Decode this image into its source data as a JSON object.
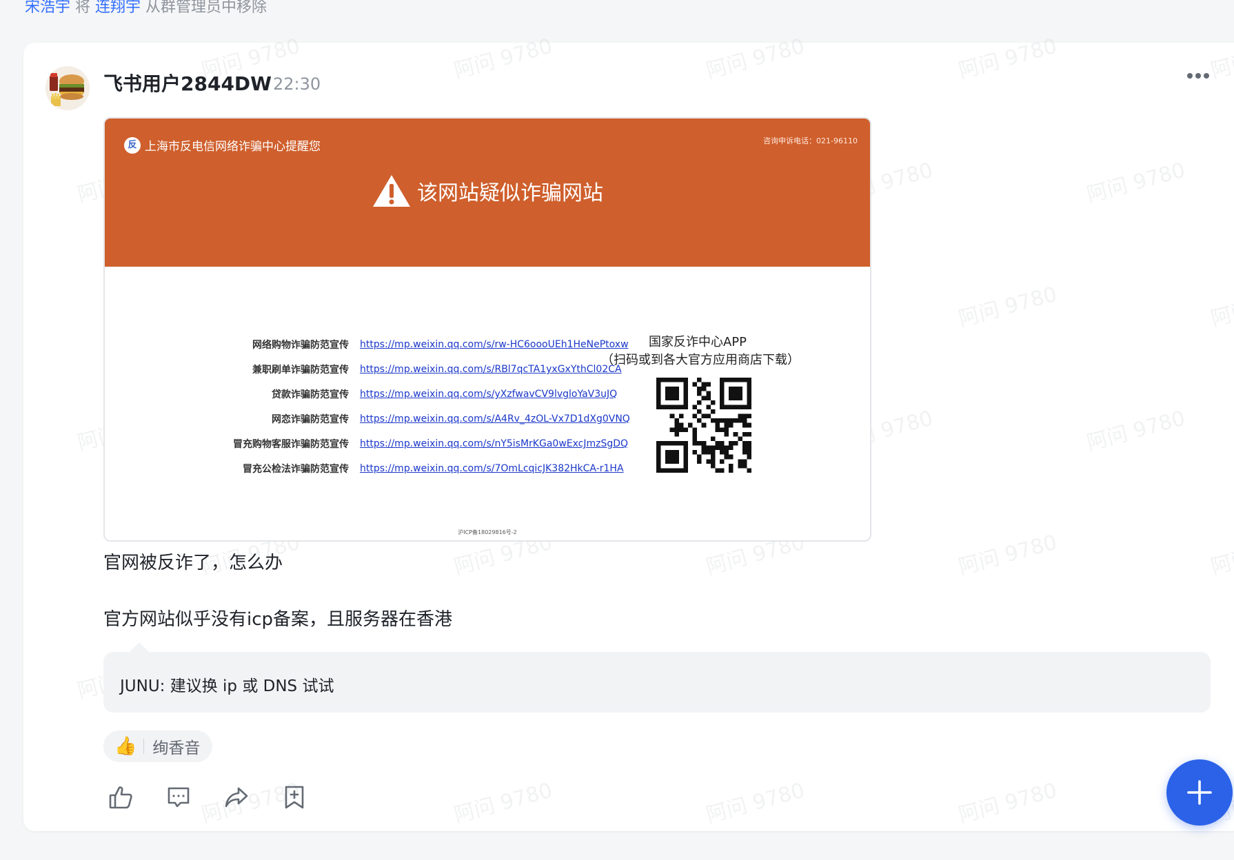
{
  "system_message": {
    "actor": "宋浩宇",
    "verb": "将",
    "target": "连翔宇",
    "action": "从群管理员中移除"
  },
  "post": {
    "author": "飞书用户2844DW",
    "time": "22:30",
    "avatar_icon": "burger-avatar-icon",
    "image": {
      "org_name": "上海市反电信网络诈骗中心提醒您",
      "org_logo": "反",
      "phone": "咨询申诉电话：021-96110",
      "warning_title": "该网站疑似诈骗网站",
      "links": [
        {
          "label": "网络购物诈骗防范宣传",
          "url": "https://mp.weixin.qq.com/s/rw-HC6oooUEh1HeNePtoxw"
        },
        {
          "label": "兼职刷单诈骗防范宣传",
          "url": "https://mp.weixin.qq.com/s/RBl7qcTA1yxGxYthCl02CA"
        },
        {
          "label": "贷款诈骗防范宣传",
          "url": "https://mp.weixin.qq.com/s/yXzfwavCV9lvgloYaV3uJQ"
        },
        {
          "label": "网恋诈骗防范宣传",
          "url": "https://mp.weixin.qq.com/s/A4Rv_4zOL-Vx7D1dXg0VNQ"
        },
        {
          "label": "冒充购物客服诈骗防范宣传",
          "url": "https://mp.weixin.qq.com/s/nY5isMrKGa0wExcJmzSgDQ"
        },
        {
          "label": "冒充公检法诈骗防范宣传",
          "url": "https://mp.weixin.qq.com/s/7OmLcqicJK382HkCA-r1HA"
        }
      ],
      "app_title": "国家反诈中心APP",
      "app_subtitle": "（扫码或到各大官方应用商店下载）",
      "footnote": "沪ICP备18029816号-2"
    },
    "text_line_1": "官网被反诈了，怎么办",
    "text_line_2": "官方网站似乎没有icp备案，且服务器在香港",
    "reply": {
      "text": "JUNU: 建议换 ip 或 DNS 试试"
    },
    "reaction": {
      "emoji": "👍",
      "who": "绚香音"
    },
    "actions": [
      "thumbs-up-icon",
      "comment-icon",
      "share-icon",
      "bookmark-add-icon"
    ]
  },
  "watermark": "阿问 9780",
  "colors": {
    "accent": "#3370ff",
    "fab": "#2b62e8",
    "banner": "#cf5f2c",
    "link": "#1a37c9"
  }
}
